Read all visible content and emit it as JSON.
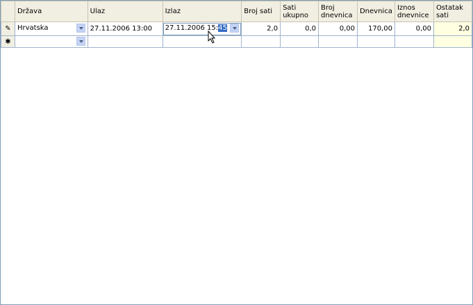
{
  "grid": {
    "headers": {
      "drzava": "Država",
      "ulaz": "Ulaz",
      "izlaz": "Izlaz",
      "broj_sati": "Broj sati",
      "sati_ukupno": "Sati ukupno",
      "broj_dnevnica": "Broj dnevnica",
      "dnevnica": "Dnevnica",
      "iznos_dnevnice": "Iznos dnevnice",
      "ostatak_sati": "Ostatak sati"
    },
    "row1": {
      "indicator": "✎",
      "drzava": "Hrvatska",
      "ulaz": "27.11.2006 13:00",
      "izlaz_prefix": "27.11.2006 15:",
      "izlaz_selected": "45",
      "broj_sati": "2,0",
      "sati_ukupno": "0,0",
      "broj_dnevnica": "0,00",
      "dnevnica": "170,00",
      "iznos_dnevnice": "0,00",
      "ostatak_sati": "2,0"
    },
    "new_row": {
      "indicator": "✱"
    }
  }
}
